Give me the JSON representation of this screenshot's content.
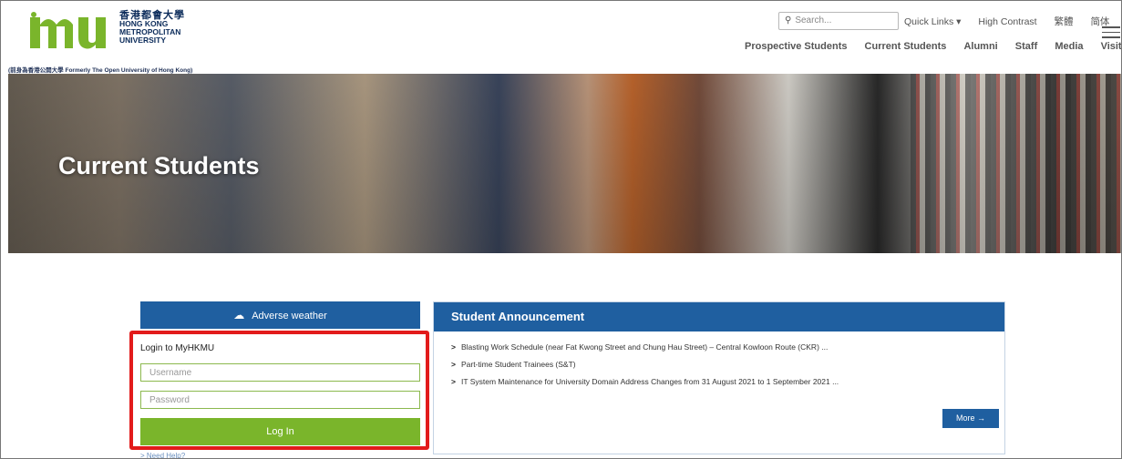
{
  "logo": {
    "name_cn": "香港都會大學",
    "name_en_1": "HONG KONG",
    "name_en_2": "METROPOLITAN",
    "name_en_3": "UNIVERSITY",
    "subtitle": "(前身為香港公開大學 Formerly The Open University of Hong Kong)"
  },
  "header": {
    "search_placeholder": "Search...",
    "top_links": [
      "Quick Links ▾",
      "High Contrast",
      "繁體",
      "简体"
    ],
    "nav": [
      "Prospective Students",
      "Current Students",
      "Alumni",
      "Staff",
      "Media",
      "Visitors"
    ]
  },
  "hero": {
    "title": "Current Students"
  },
  "weather": {
    "label": "Adverse weather"
  },
  "login": {
    "title": "Login to MyHKMU",
    "username_placeholder": "Username",
    "password_placeholder": "Password",
    "button": "Log In",
    "help": "> Need Help?"
  },
  "announcement": {
    "heading": "Student Announcement",
    "items": [
      "Blasting Work Schedule (near Fat Kwong Street and Chung Hau Street) – Central Kowloon Route (CKR) ...",
      "Part-time Student Trainees (S&T)",
      "IT System Maintenance for University Domain Address Changes from 31 August 2021 to 1 September 2021 ..."
    ],
    "more": "More →"
  },
  "colors": {
    "brand_green": "#7ab52b",
    "brand_blue": "#1f5fa0",
    "highlight_red": "#e21b1b"
  }
}
